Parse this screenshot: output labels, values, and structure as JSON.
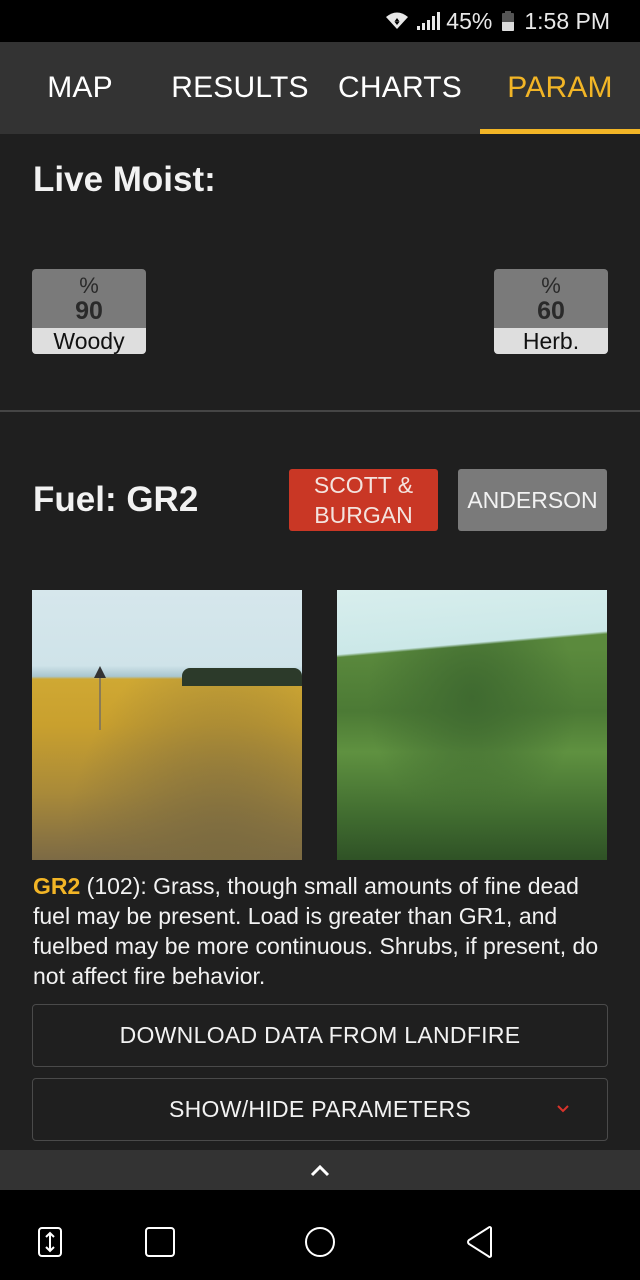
{
  "status_bar": {
    "battery_percent": "45%",
    "time": "1:58 PM",
    "icons": [
      "wifi-icon",
      "signal-icon",
      "battery-icon"
    ]
  },
  "tabs": [
    {
      "label": "MAP",
      "active": false
    },
    {
      "label": "RESULTS",
      "active": false
    },
    {
      "label": "CHARTS",
      "active": false
    },
    {
      "label": "PARAM",
      "active": true
    }
  ],
  "live_moist": {
    "title": "Live Moist:",
    "woody": {
      "unit": "%",
      "value": "90",
      "label": "Woody"
    },
    "herb": {
      "unit": "%",
      "value": "60",
      "label": "Herb."
    }
  },
  "fuel": {
    "title": "Fuel: GR2",
    "model_buttons": {
      "scott_burgan": "SCOTT & BURGAN",
      "anderson": "ANDERSON"
    },
    "selected_model": "SCOTT & BURGAN",
    "photos": [
      {
        "alt": "GR2 fuel photo: dry yellow grass field with marker"
      },
      {
        "alt": "GR2 fuel photo: green grassy hillside"
      }
    ],
    "description": {
      "code": "GR2",
      "text": " (102): Grass, though small amounts of fine dead fuel may be present. Load is greater than GR1, and fuelbed may be more continuous. Shrubs, if present, do not affect fire behavior."
    }
  },
  "actions": {
    "download": "DOWNLOAD DATA FROM LANDFIRE",
    "toggle_parameters": "SHOW/HIDE PARAMETERS"
  },
  "colors": {
    "accent": "#f2b526",
    "selected_model": "#c93725",
    "unselected_model": "#7a7a7a",
    "background": "#1f1f1f",
    "tab_bar": "#333333"
  },
  "nav_bar": {
    "buttons": [
      "screen-extend",
      "recent-apps",
      "home",
      "back"
    ]
  }
}
